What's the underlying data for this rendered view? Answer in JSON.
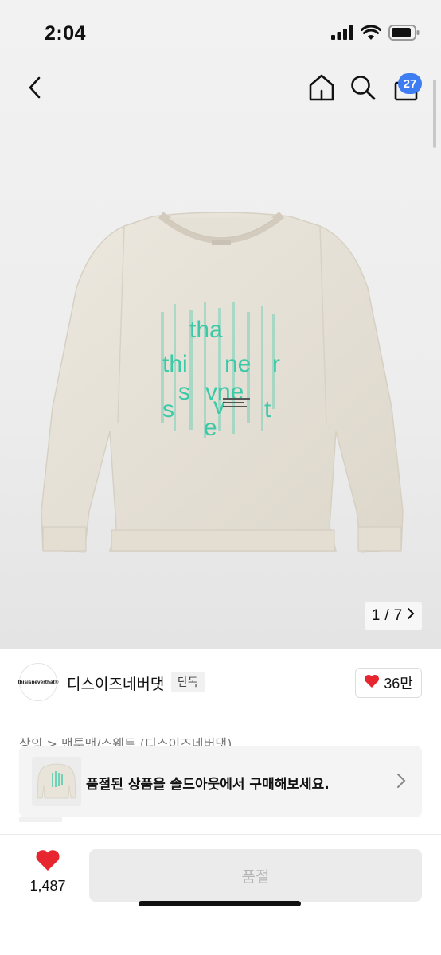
{
  "status_bar": {
    "time": "2:04"
  },
  "nav": {
    "cart_count": "27"
  },
  "gallery": {
    "current": "1",
    "separator": "/",
    "total": "7"
  },
  "product_print": {
    "lines": [
      "tha",
      "thi   ne r",
      "s vne",
      "s  v e  t",
      "e"
    ]
  },
  "brand": {
    "logo_text": "thisisneverthat®",
    "name": "디스이즈네버댓",
    "badge": "단독",
    "likes": "36만"
  },
  "breadcrumb": "상의 > 맨투맨/스웨트 (디스이즈네버댓)",
  "soldout_banner": {
    "message": "품절된 상품을 솔드아웃에서 구매해보세요."
  },
  "bottom": {
    "wish_count": "1,487",
    "buy_label": "품절"
  },
  "colors": {
    "accent": "#3e7cf2",
    "heart": "#e8262f",
    "print": "#3cc9a8",
    "sweatshirt": "#e9e4da"
  }
}
